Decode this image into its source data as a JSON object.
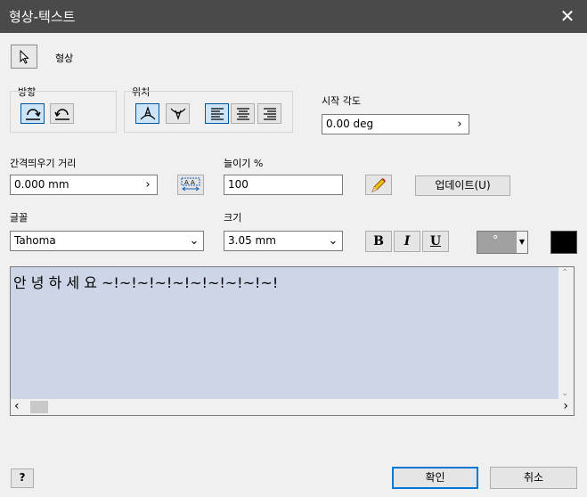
{
  "window": {
    "title": "형상-텍스트",
    "close_glyph": "✕"
  },
  "shape": {
    "label": "형상"
  },
  "direction": {
    "label": "방향"
  },
  "position": {
    "label": "위치"
  },
  "start_angle": {
    "label": "시작 각도",
    "value": "0.00 deg"
  },
  "spacing": {
    "label": "간격띄우기 거리",
    "value": "0.000 mm"
  },
  "stretch": {
    "label": "늘이기 %",
    "value": "100"
  },
  "update_button": "업데이트(U)",
  "font": {
    "label": "글꼴",
    "value": "Tahoma"
  },
  "size": {
    "label": "크기",
    "value": "3.05 mm"
  },
  "style": {
    "bold": "B",
    "italic": "I",
    "underline": "U",
    "color_dot": "°"
  },
  "text_content": "안 녕 하 세 요 ~!~!~!~!~!~!~!~!~!~!",
  "buttons": {
    "ok": "확인",
    "cancel": "취소",
    "help": "?"
  },
  "colors": {
    "titlebar": "#4a4a4a",
    "text_bg": "#cdd6e6",
    "swatch": "#000000"
  }
}
